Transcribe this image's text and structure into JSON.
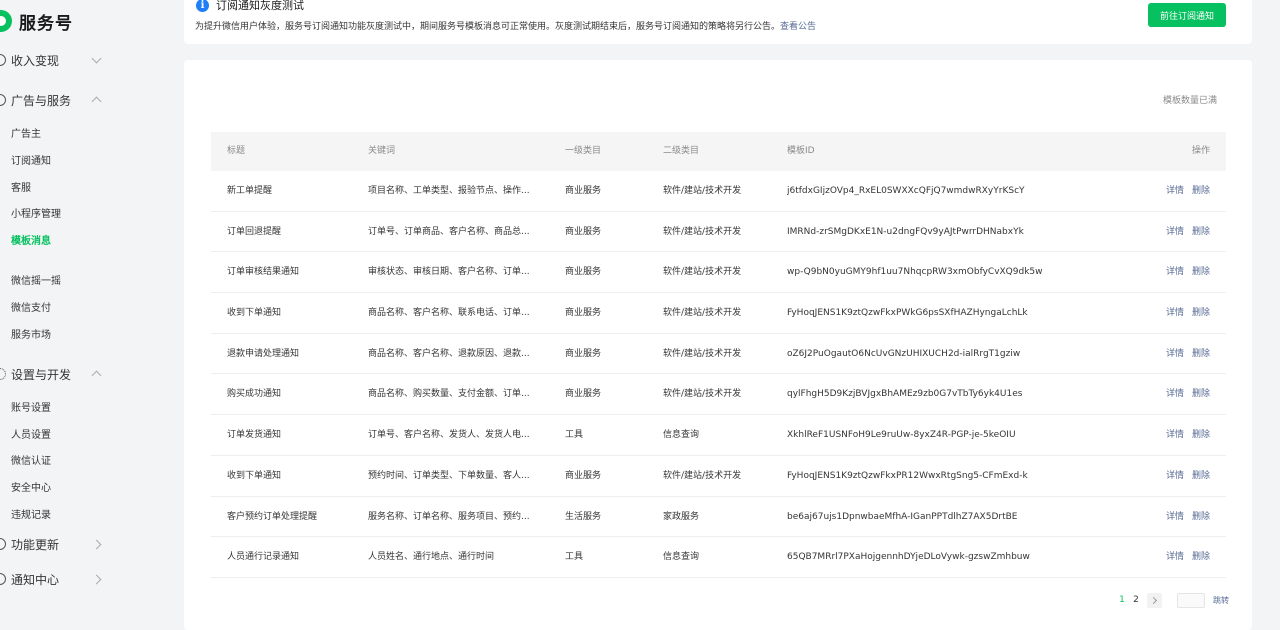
{
  "brand": {
    "name": "服务号"
  },
  "sidebar": {
    "groups": [
      {
        "label": "收入变现",
        "icon": "coin-icon"
      },
      {
        "label": "广告与服务",
        "icon": "grid-icon"
      },
      {
        "label": "设置与开发",
        "icon": "gear-icon"
      },
      {
        "label": "功能更新",
        "icon": "update-icon"
      },
      {
        "label": "通知中心",
        "icon": "bell-icon"
      }
    ],
    "ad_items": [
      "广告主",
      "订阅通知",
      "客服",
      "小程序管理",
      "模板消息"
    ],
    "ad_items_2": [
      "微信摇一摇",
      "微信支付",
      "服务市场"
    ],
    "settings_items": [
      "账号设置",
      "人员设置",
      "微信认证",
      "安全中心",
      "违规记录"
    ],
    "active_item": "模板消息"
  },
  "notice": {
    "icon": "info-icon",
    "title": "订阅通知灰度测试",
    "desc": "为提升微信用户体验，服务号订阅通知功能灰度测试中，期间服务号模板消息可正常使用。灰度测试期结束后，服务号订阅通知的策略将另行公告。",
    "link": "查看公告",
    "button": "前往订阅通知"
  },
  "main": {
    "quota_text": "模板数量已满",
    "columns": {
      "title": "标题",
      "keywords": "关键词",
      "cat1": "一级类目",
      "cat2": "二级类目",
      "id": "模板ID",
      "ops": "操作"
    },
    "rows": [
      {
        "title": "新工单提醒",
        "keywords": "项目名称、工单类型、报验节点、操作...",
        "cat1": "商业服务",
        "cat2": "软件/建站/技术开发",
        "id": "j6tfdxGIjzOVp4_RxEL0SWXXcQFjQ7wmdwRXyYrKScY",
        "detail": "详情",
        "delete": "删除"
      },
      {
        "title": "订单回退提醒",
        "keywords": "订单号、订单商品、客户名称、商品总...",
        "cat1": "商业服务",
        "cat2": "软件/建站/技术开发",
        "id": "IMRNd-zrSMgDKxE1N-u2dngFQv9yAJtPwrrDHNabxYk",
        "detail": "详情",
        "delete": "删除"
      },
      {
        "title": "订单审核结果通知",
        "keywords": "审核状态、审核日期、客户名称、订单...",
        "cat1": "商业服务",
        "cat2": "软件/建站/技术开发",
        "id": "wp-Q9bN0yuGMY9hf1uu7NhqcpRW3xmObfyCvXQ9dk5w",
        "detail": "详情",
        "delete": "删除"
      },
      {
        "title": "收到下单通知",
        "keywords": "商品名称、客户名称、联系电话、订单...",
        "cat1": "商业服务",
        "cat2": "软件/建站/技术开发",
        "id": "FyHoqJENS1K9ztQzwFkxPWkG6psSXfHAZHyngaLchLk",
        "detail": "详情",
        "delete": "删除"
      },
      {
        "title": "退款申请处理通知",
        "keywords": "商品名称、客户名称、退款原因、退款...",
        "cat1": "商业服务",
        "cat2": "软件/建站/技术开发",
        "id": "oZ6J2PuOgautO6NcUvGNzUHIXUCH2d-ialRrgT1gziw",
        "detail": "详情",
        "delete": "删除"
      },
      {
        "title": "购买成功通知",
        "keywords": "商品名称、购买数量、支付金额、订单...",
        "cat1": "商业服务",
        "cat2": "软件/建站/技术开发",
        "id": "qylFhgH5D9KzjBVJgxBhAMEz9zb0G7vTbTy6yk4U1es",
        "detail": "详情",
        "delete": "删除"
      },
      {
        "title": "订单发货通知",
        "keywords": "订单号、客户名称、发货人、发货人电...",
        "cat1": "工具",
        "cat2": "信息查询",
        "id": "XkhlReF1USNFoH9Le9ruUw-8yxZ4R-PGP-je-5keOIU",
        "detail": "详情",
        "delete": "删除"
      },
      {
        "title": "收到下单通知",
        "keywords": "预约时间、订单类型、下单数量、客人...",
        "cat1": "商业服务",
        "cat2": "软件/建站/技术开发",
        "id": "FyHoqJENS1K9ztQzwFkxPR12WwxRtgSng5-CFmExd-k",
        "detail": "详情",
        "delete": "删除"
      },
      {
        "title": "客户预约订单处理提醒",
        "keywords": "服务名称、订单名称、服务项目、预约...",
        "cat1": "生活服务",
        "cat2": "家政服务",
        "id": "be6aj67ujs1DpnwbaeMfhA-IGanPPTdlhZ7AX5DrtBE",
        "detail": "详情",
        "delete": "删除"
      },
      {
        "title": "人员通行记录通知",
        "keywords": "人员姓名、通行地点、通行时间",
        "cat1": "工具",
        "cat2": "信息查询",
        "id": "65QB7MRrl7PXaHojgennhDYjeDLoVywk-gzswZmhbuw",
        "detail": "详情",
        "delete": "删除"
      }
    ]
  },
  "pagination": {
    "pages": [
      "1",
      "2"
    ],
    "current": "1",
    "jump_label": "跳转"
  },
  "colors": {
    "accent": "#07c160",
    "link": "#576b95",
    "info": "#1f7ef8"
  }
}
